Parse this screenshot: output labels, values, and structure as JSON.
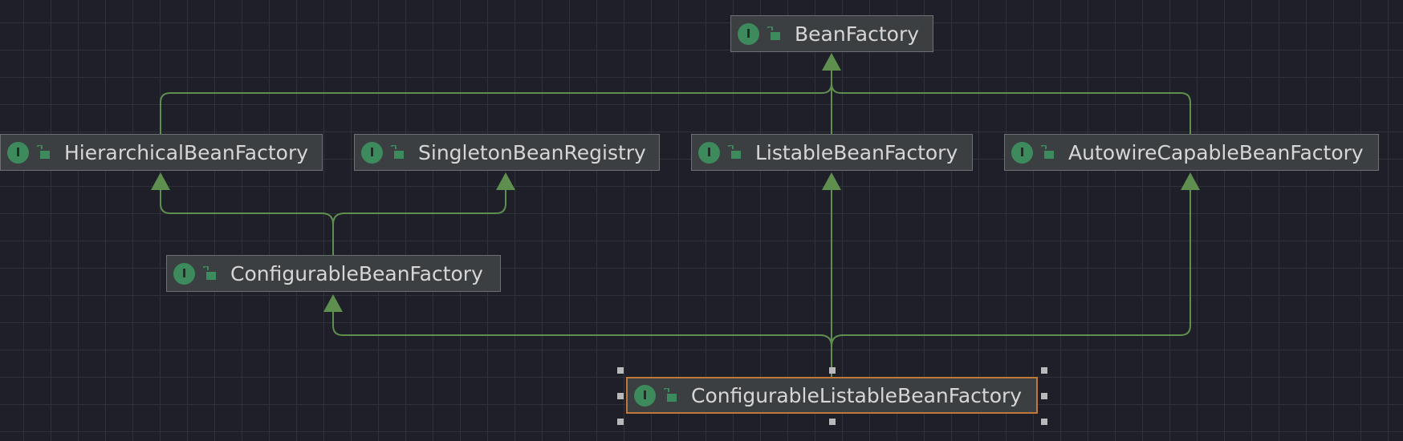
{
  "diagram": {
    "kind": "uml-class-hierarchy",
    "badge_letter": "I",
    "badge_icon": "interface-icon",
    "visibility_icon": "public-unlock-icon",
    "colors": {
      "background": "#1e1f28",
      "node_fill": "#3c3f41",
      "node_border": "#6d6f72",
      "selected_border": "#c0773a",
      "badge": "#3d8a5c",
      "edge": "#5f8f4e"
    },
    "nodes": [
      {
        "id": "bean-factory",
        "label": "BeanFactory"
      },
      {
        "id": "hierarchical-bean-factory",
        "label": "HierarchicalBeanFactory"
      },
      {
        "id": "singleton-bean-registry",
        "label": "SingletonBeanRegistry"
      },
      {
        "id": "listable-bean-factory",
        "label": "ListableBeanFactory"
      },
      {
        "id": "autowire-capable-bean-factory",
        "label": "AutowireCapableBeanFactory"
      },
      {
        "id": "configurable-bean-factory",
        "label": "ConfigurableBeanFactory"
      },
      {
        "id": "configurable-listable-bean-factory",
        "label": "ConfigurableListableBeanFactory",
        "selected": true
      }
    ],
    "edges": [
      {
        "from": "hierarchical-bean-factory",
        "to": "bean-factory",
        "relation": "extends"
      },
      {
        "from": "listable-bean-factory",
        "to": "bean-factory",
        "relation": "extends"
      },
      {
        "from": "autowire-capable-bean-factory",
        "to": "bean-factory",
        "relation": "extends"
      },
      {
        "from": "configurable-bean-factory",
        "to": "hierarchical-bean-factory",
        "relation": "extends"
      },
      {
        "from": "configurable-bean-factory",
        "to": "singleton-bean-registry",
        "relation": "extends"
      },
      {
        "from": "configurable-listable-bean-factory",
        "to": "configurable-bean-factory",
        "relation": "extends"
      },
      {
        "from": "configurable-listable-bean-factory",
        "to": "listable-bean-factory",
        "relation": "extends"
      },
      {
        "from": "configurable-listable-bean-factory",
        "to": "autowire-capable-bean-factory",
        "relation": "extends"
      }
    ]
  }
}
